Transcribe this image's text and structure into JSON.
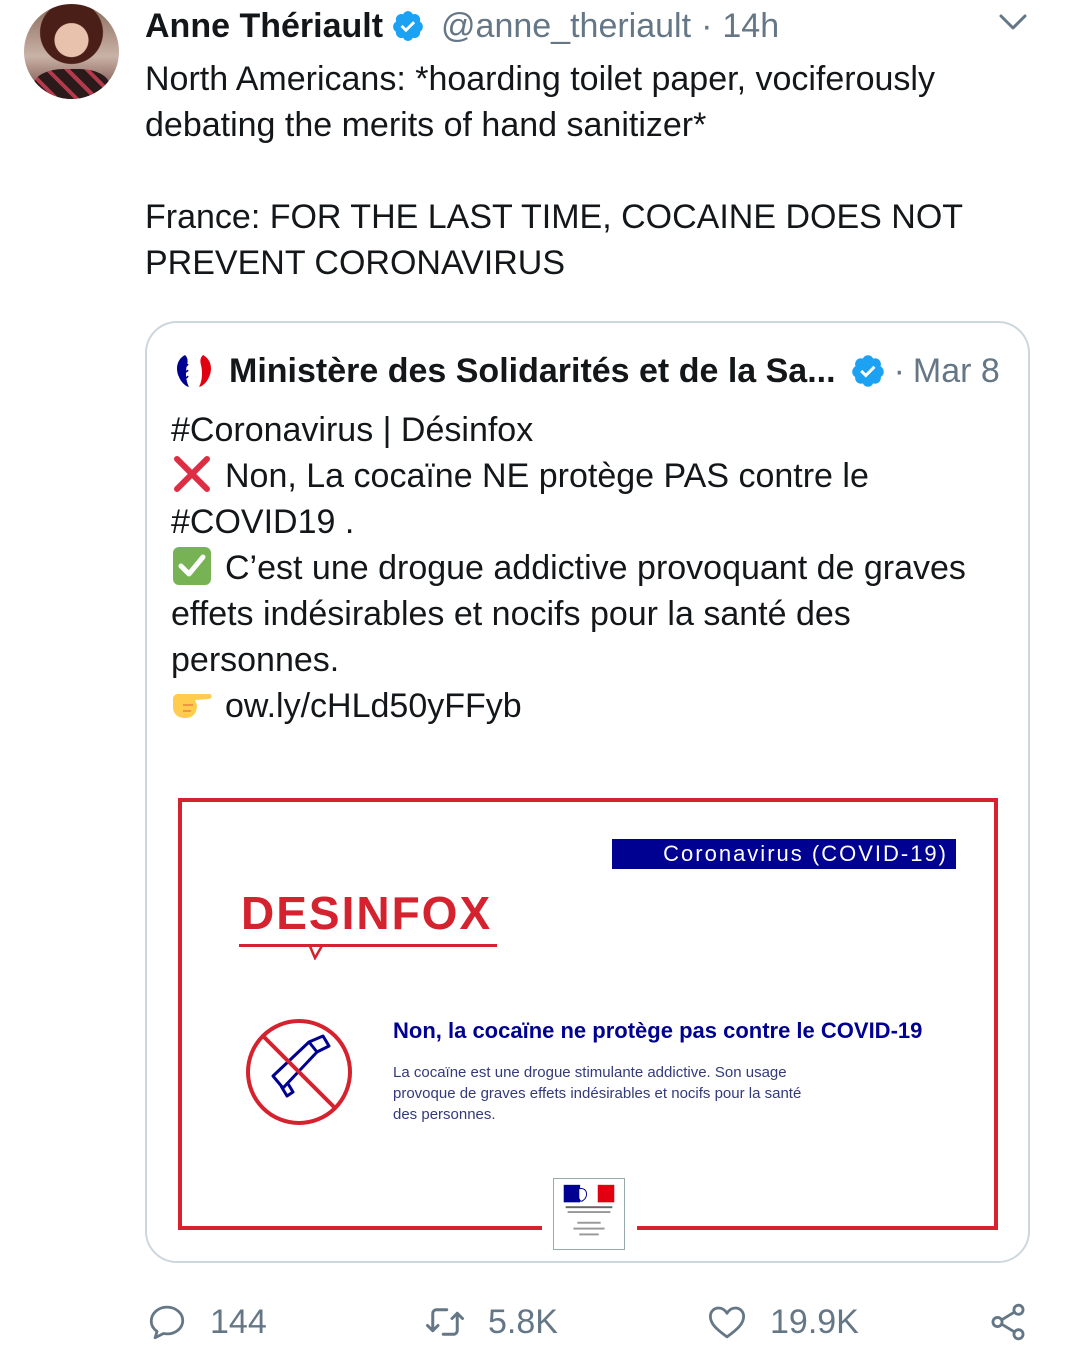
{
  "tweet": {
    "display_name": "Anne Thériault",
    "handle": "@anne_theriault",
    "separator": "·",
    "time": "14h",
    "text": [
      "North Americans: *hoarding toilet paper, vociferously debating the merits of hand sanitizer*",
      "France: FOR THE LAST TIME, COCAINE DOES NOT PREVENT CORONAVIRUS"
    ]
  },
  "quoted": {
    "display_name": "Ministère des Solidarités et de la Sa...",
    "separator": "·",
    "time": "Mar 8",
    "lines": {
      "l1": "#Coronavirus | Désinfox",
      "l2": "Non, La cocaïne NE protège PAS contre le #COVID19 .",
      "l3": "C’est une drogue addictive provoquant de graves effets indésirables et nocifs pour la santé des personnes.",
      "l4": "ow.ly/cHLd50yFFyb"
    },
    "emoji": [
      "cross-mark-emoji",
      "check-mark-emoji",
      "pointing-hand-emoji"
    ],
    "card": {
      "banner": "Coronavirus (COVID-19)",
      "brand": "DESINFOX",
      "title": "Non, la cocaïne ne protège pas contre le COVID-19",
      "body": "La cocaïne est une drogue stimulante addictive. Son usage provoque de graves effets indésirables et nocifs pour la santé des personnes.",
      "colors": {
        "red": "#d4222e",
        "navy": "#000091"
      }
    }
  },
  "actions": {
    "reply_count": "144",
    "retweet_count": "5.8K",
    "like_count": "19.9K"
  },
  "icons": [
    "verified-badge-icon",
    "caret-down-icon",
    "reply-icon",
    "retweet-icon",
    "like-icon",
    "share-icon"
  ],
  "colors": {
    "text": "#14171a",
    "muted": "#657786",
    "verified": "#1da1f2",
    "border": "#ccd6dd"
  }
}
